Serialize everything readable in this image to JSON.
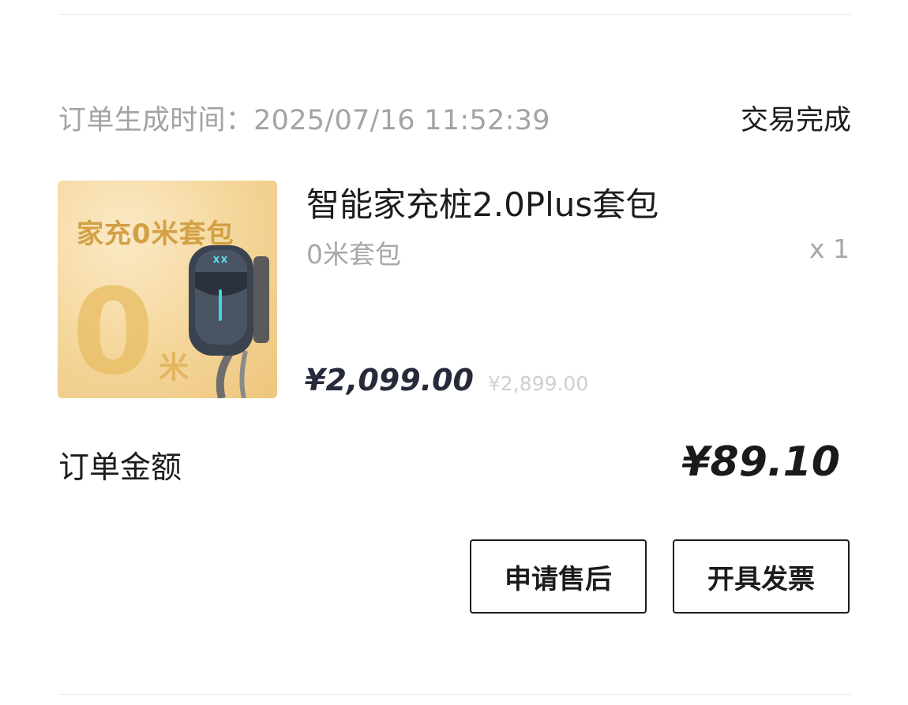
{
  "order": {
    "created_time_label": "订单生成时间：2025/07/16 11:52:39",
    "status": "交易完成"
  },
  "product": {
    "thumbnail": {
      "title": "家充0米套包",
      "big_number": "0",
      "unit": "米",
      "colors": {
        "background": "#f5d9a0",
        "text": "#d2a045"
      }
    },
    "name": "智能家充桩2.0Plus套包",
    "variant": "0米套包",
    "quantity": "x 1",
    "price_current": "¥2,099.00",
    "price_original": "¥2,899.00"
  },
  "total": {
    "label": "订单金额",
    "value": "¥89.10"
  },
  "actions": {
    "after_sale_label": "申请售后",
    "invoice_label": "开具发票"
  }
}
